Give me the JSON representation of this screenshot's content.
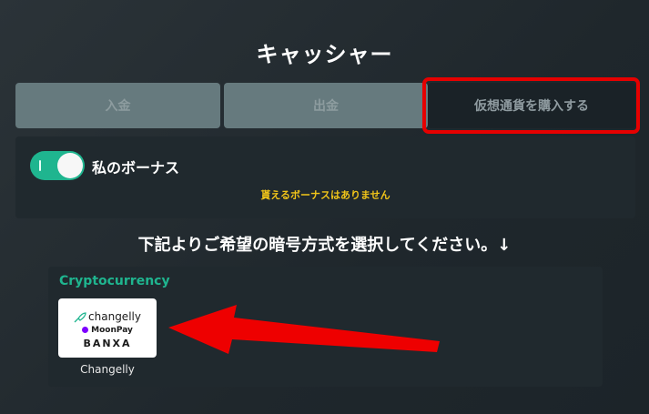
{
  "header": {
    "title": "キャッシャー"
  },
  "tabs": [
    {
      "label": "入金",
      "state": "inactive"
    },
    {
      "label": "出金",
      "state": "inactive"
    },
    {
      "label": "仮想通貨を購入する",
      "state": "active"
    }
  ],
  "bonus": {
    "label": "私のボーナス",
    "toggle_on": true,
    "note": "貰えるボーナスはありません"
  },
  "instruction": "下記よりご希望の暗号方式を選択してください。↓",
  "crypto": {
    "heading": "Cryptocurrency",
    "providers": [
      {
        "name": "Changelly",
        "logos": {
          "changelly": "changelly",
          "moonpay": "MoonPay",
          "banxa": "BANXA"
        }
      }
    ]
  },
  "colors": {
    "accent": "#1fb58f",
    "note": "#f0c419",
    "highlight": "#e60000"
  }
}
